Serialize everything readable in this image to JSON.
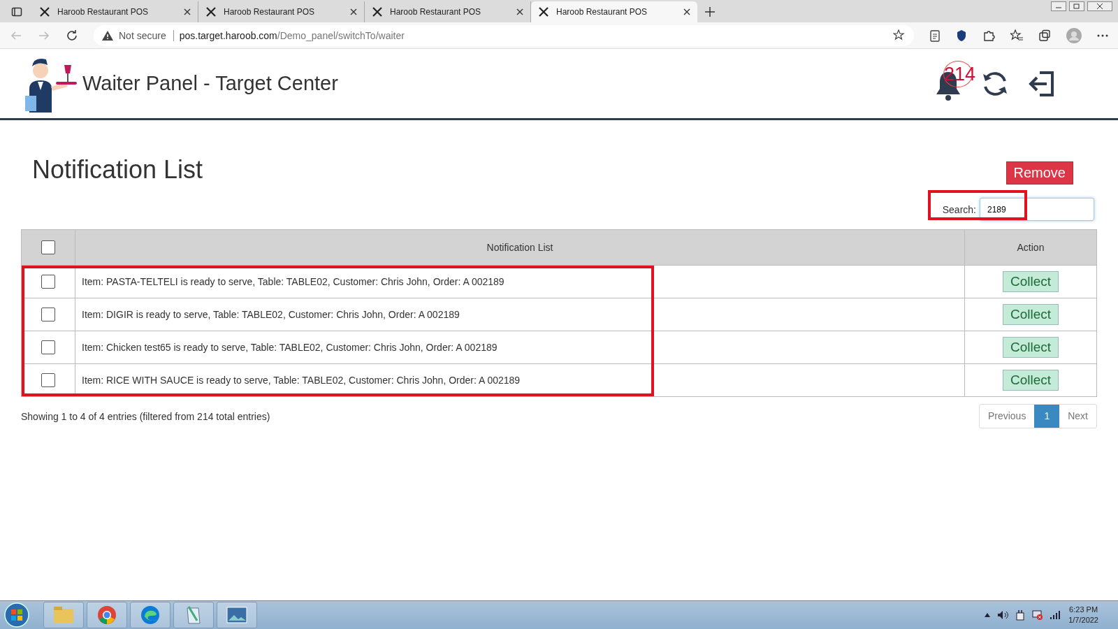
{
  "browser": {
    "tabs": [
      {
        "title": "Haroob Restaurant POS",
        "selected": false
      },
      {
        "title": "Haroob Restaurant POS",
        "selected": false
      },
      {
        "title": "Haroob Restaurant POS",
        "selected": false
      },
      {
        "title": "Haroob Restaurant POS",
        "selected": true
      }
    ],
    "address": {
      "security": "Not secure",
      "host": "pos.target.haroob.com",
      "path": "/Demo_panel/switchTo/waiter"
    }
  },
  "header": {
    "title": "Waiter Panel - Target Center",
    "notification_count": "214"
  },
  "page": {
    "heading": "Notification List",
    "remove_button": "Remove",
    "search": {
      "label": "Search:",
      "value": "2189"
    },
    "table": {
      "select_all": {
        "checked": false
      },
      "columns": [
        "Notification List",
        "Action"
      ],
      "rows": [
        {
          "checked": false,
          "text": "Item: PASTA-TELTELI is ready to serve, Table: TABLE02, Customer: Chris John, Order: A 002189",
          "action": "Collect"
        },
        {
          "checked": false,
          "text": "Item: DIGIR is ready to serve, Table: TABLE02, Customer: Chris John, Order: A 002189",
          "action": "Collect"
        },
        {
          "checked": false,
          "text": "Item: Chicken test65 is ready to serve, Table: TABLE02, Customer: Chris John, Order: A 002189",
          "action": "Collect"
        },
        {
          "checked": false,
          "text": "Item: RICE WITH SAUCE is ready to serve, Table: TABLE02, Customer: Chris John, Order: A 002189",
          "action": "Collect"
        }
      ]
    },
    "info": "Showing 1 to 4 of 4 entries (filtered from 214 total entries)",
    "pagination": [
      {
        "label": "Previous",
        "selected": false
      },
      {
        "label": "1",
        "selected": true
      },
      {
        "label": "Next",
        "selected": false
      }
    ]
  },
  "taskbar": {
    "time": "6:23 PM",
    "date": "1/7/2022"
  }
}
